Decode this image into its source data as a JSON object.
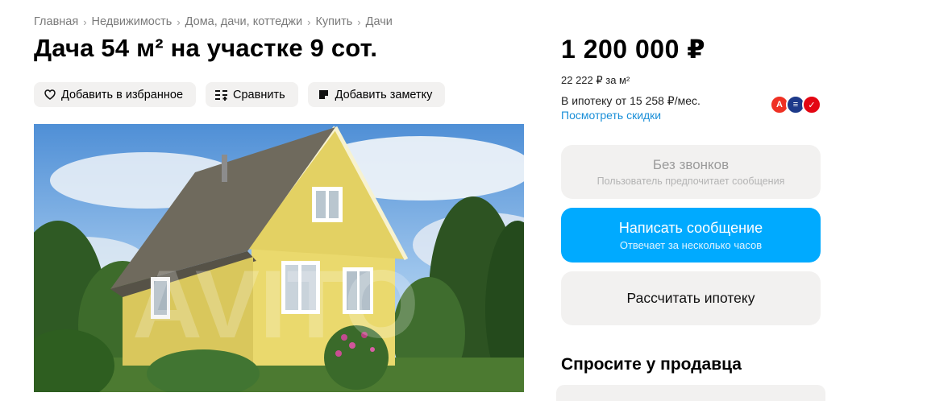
{
  "breadcrumb": [
    "Главная",
    "Недвижимость",
    "Дома, дачи, коттеджи",
    "Купить",
    "Дачи"
  ],
  "breadcrumb_separator": "›",
  "title": "Дача 54 м² на участке 9 сот.",
  "actions": {
    "favorite": "Добавить в избранное",
    "compare": "Сравнить",
    "note": "Добавить заметку"
  },
  "photo": {
    "watermark": "AVITO"
  },
  "price": {
    "main": "1 200 000 ₽",
    "per_meter": "22 222 ₽ за м²",
    "mortgage": "В ипотеку от 15 258 ₽/мес.",
    "discounts_link": "Посмотреть скидки"
  },
  "banks": [
    {
      "name": "alfa-bank-icon",
      "glyph": "А",
      "color": "#ef3124"
    },
    {
      "name": "bank-icon",
      "glyph": "≡",
      "color": "#1d3a8a"
    },
    {
      "name": "bank-icon",
      "glyph": "✓",
      "color": "#e30613"
    }
  ],
  "contact": {
    "no_calls_title": "Без звонков",
    "no_calls_sub": "Пользователь предпочитает сообщения",
    "message_title": "Написать сообщение",
    "message_sub": "Отвечает за несколько часов",
    "mortgage_button": "Рассчитать ипотеку"
  },
  "ask_seller_heading": "Спросите у продавца",
  "colors": {
    "accent": "#00aaff",
    "link": "#1a8fd8",
    "button_bg": "#f2f1f0"
  }
}
